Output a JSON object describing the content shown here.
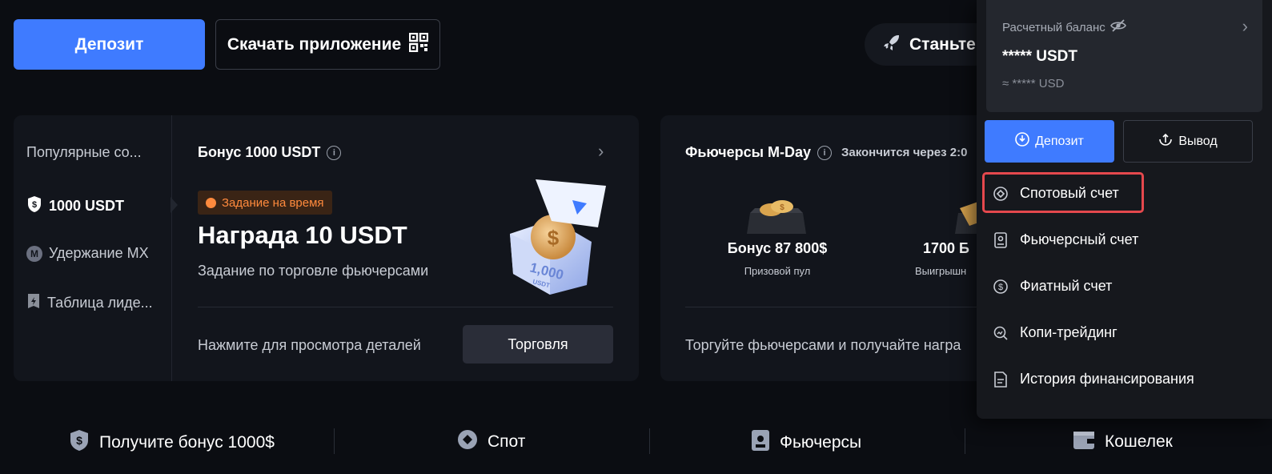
{
  "top_bar": {
    "deposit_label": "Депозит",
    "download_label": "Скачать приложение",
    "become_label": "Станьте"
  },
  "promo_card": {
    "sidebar_title": "Популярные со...",
    "sidebar_items": [
      {
        "label": "1000 USDT",
        "icon": "usdt-shield-icon",
        "active": true
      },
      {
        "label": "Удержание MX",
        "icon": "mx-coin-icon",
        "active": false
      },
      {
        "label": "Таблица лиде...",
        "icon": "leaderboard-icon",
        "active": false
      }
    ],
    "title": "Бонус 1000 USDT",
    "badge": "Задание на время",
    "reward": "Награда 10 USDT",
    "subtitle": "Задание по торговле фьючерсами",
    "illustration_text": "1,000",
    "illustration_sub": "USDT",
    "footer_text": "Нажмите для просмотра деталей",
    "trade_label": "Торговля"
  },
  "futures_card": {
    "title": "Фьючерсы M-Day",
    "ends": "Закончится через 2:0",
    "stats": [
      {
        "value": "Бонус 87 800$",
        "label": "Призовой пул"
      },
      {
        "value": "1700 Б",
        "label": "Выигрышн"
      }
    ],
    "footer_text": "Торгуйте фьючерсами и получайте награ"
  },
  "bottom_nav": [
    {
      "label": "Получите бонус 1000$",
      "icon": "bonus-shield-icon"
    },
    {
      "label": "Спот",
      "icon": "spot-diamond-icon"
    },
    {
      "label": "Фьючерсы",
      "icon": "futures-icon"
    },
    {
      "label": "Кошелек",
      "icon": "wallet-icon"
    }
  ],
  "balance_panel": {
    "label": "Расчетный баланс",
    "amount": "***** USDT",
    "usd": "≈ ***** USD",
    "deposit_label": "Депозит",
    "withdraw_label": "Вывод",
    "menu": [
      {
        "label": "Спотовый счет",
        "icon": "spot-account-icon",
        "highlighted": true
      },
      {
        "label": "Фьючерсный счет",
        "icon": "futures-account-icon",
        "highlighted": false
      },
      {
        "label": "Фиатный счет",
        "icon": "fiat-dollar-icon",
        "highlighted": false
      },
      {
        "label": "Копи-трейдинг",
        "icon": "copy-trading-icon",
        "highlighted": false
      },
      {
        "label": "История финансирования",
        "icon": "history-document-icon",
        "highlighted": false
      }
    ]
  },
  "colors": {
    "accent": "#3f7bff",
    "background": "#0b0d12",
    "card": "#12151c",
    "badge_orange": "#ff8a3d",
    "highlight_red": "#e5484d"
  }
}
